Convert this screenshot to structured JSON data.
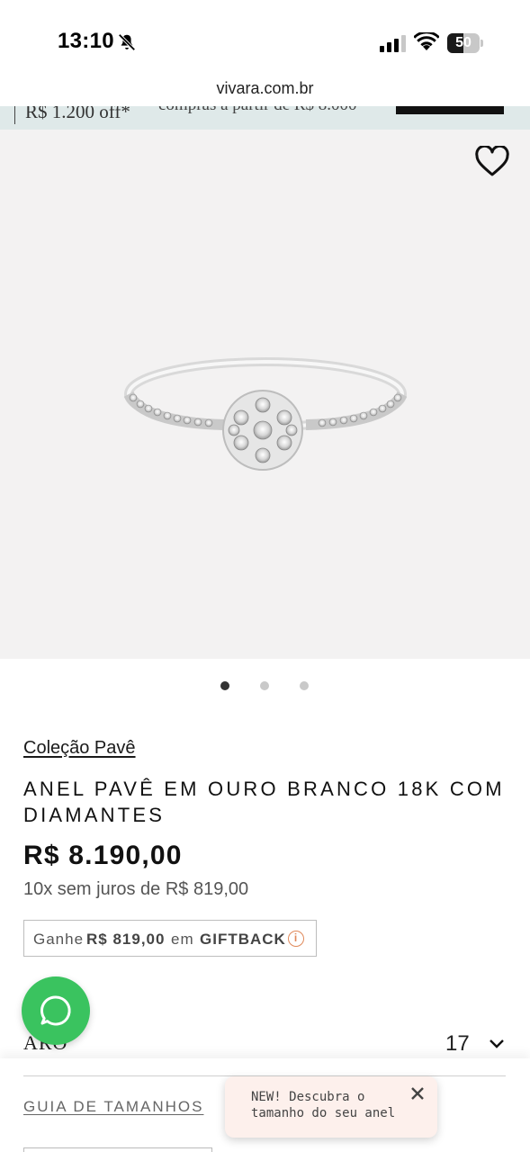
{
  "status_bar": {
    "time": "13:10",
    "battery_level": "50",
    "battery_fraction": 0.5
  },
  "browser": {
    "url": "vivara.com.br"
  },
  "promo": {
    "left_text": "R$ 1.200 off*",
    "right_text": "compras a partir de R$ 8.000"
  },
  "gallery": {
    "page_count": 3,
    "active_page": 1
  },
  "product": {
    "collection": "Coleção Pavê",
    "title": "ANEL PAVÊ EM OURO BRANCO 18K COM DIAMANTES",
    "price": "R$ 8.190,00",
    "installments": "10x sem juros de R$ 819,00",
    "giftback": {
      "prefix": "Ganhe",
      "amount": "R$ 819,00",
      "middle": "em",
      "label": "GIFTBACK",
      "info_glyph": "i"
    }
  },
  "size_selector": {
    "label": "ARO",
    "value": "17"
  },
  "size_guide": {
    "label": "GUIA DE TAMANHOS"
  },
  "tooltip": {
    "message": "NEW! Descubra o tamanho do seu anel"
  },
  "colors": {
    "whatsapp": "#3ac35f",
    "tooltip_bg": "#fdf0ec",
    "gallery_bg": "#f3f2f2",
    "promo_bg": "#dfe9e9",
    "info_accent": "#e0895a"
  },
  "icons": [
    "bell-slash-icon",
    "signal-icon",
    "wifi-icon",
    "battery-icon",
    "heart-icon",
    "chevron-down-icon",
    "whatsapp-icon",
    "close-icon",
    "info-icon"
  ]
}
